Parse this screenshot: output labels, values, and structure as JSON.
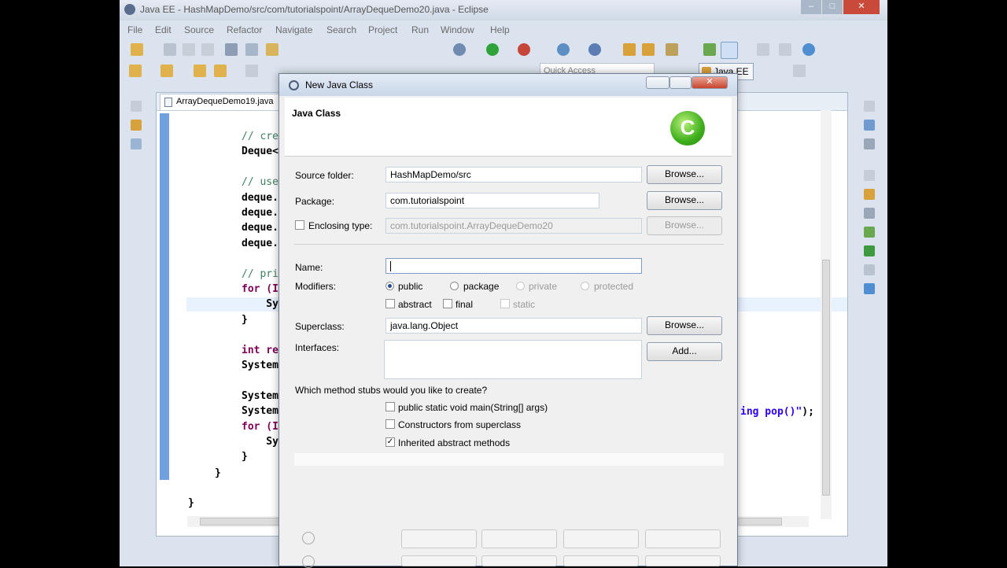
{
  "window": {
    "title": "Java EE - HashMapDemo/src/com/tutorialspoint/ArrayDequeDemo20.java - Eclipse",
    "controls": [
      "–",
      "□",
      "✕"
    ]
  },
  "menu": [
    "File",
    "Edit",
    "Source",
    "Refactor",
    "Navigate",
    "Search",
    "Project",
    "Run",
    "Window",
    "Help"
  ],
  "toolbar": {
    "quick_access_placeholder": "Quick Access",
    "perspective_label": "Java EE"
  },
  "editor": {
    "tab_label": "ArrayDequeDemo19.java",
    "code_lines": [
      {
        "cls": "c-cmt",
        "text": "// cre"
      },
      {
        "cls": "",
        "text": "Deque<"
      },
      {
        "cls": "",
        "text": ""
      },
      {
        "cls": "c-cmt",
        "text": "// use"
      },
      {
        "cls": "",
        "text": "deque."
      },
      {
        "cls": "",
        "text": "deque."
      },
      {
        "cls": "",
        "text": "deque."
      },
      {
        "cls": "",
        "text": "deque."
      },
      {
        "cls": "",
        "text": ""
      },
      {
        "cls": "c-cmt",
        "text": "// pri"
      },
      {
        "cls": "c-kw",
        "text": "for (I"
      },
      {
        "cls": "",
        "text": "    Sy"
      },
      {
        "cls": "",
        "text": "}"
      },
      {
        "cls": "",
        "text": ""
      },
      {
        "cls": "c-kw",
        "text": "int re"
      },
      {
        "cls": "",
        "text": "System"
      },
      {
        "cls": "",
        "text": ""
      },
      {
        "cls": "",
        "text": "System"
      },
      {
        "cls": "",
        "text": "System"
      },
      {
        "cls": "c-kw",
        "text": "for (I"
      },
      {
        "cls": "",
        "text": "    Sy"
      },
      {
        "cls": "",
        "text": "}"
      }
    ],
    "closing_brace_inner": "}",
    "closing_brace_outer": "}",
    "right_fragment_str": "ing pop()\"",
    "right_fragment_end": ");"
  },
  "dialog": {
    "title": "New Java Class",
    "heading": "Java Class",
    "class_icon_letter": "C",
    "source_folder_label": "Source folder:",
    "source_folder_value": "HashMapDemo/src",
    "package_label": "Package:",
    "package_value": "com.tutorialspoint",
    "enclosing_type_label": "Enclosing type:",
    "enclosing_type_value": "com.tutorialspoint.ArrayDequeDemo20",
    "browse_label": "Browse...",
    "name_label": "Name:",
    "name_value": "",
    "modifiers_label": "Modifiers:",
    "modifier_public": "public",
    "modifier_package": "package",
    "modifier_private": "private",
    "modifier_protected": "protected",
    "modifier_abstract": "abstract",
    "modifier_final": "final",
    "modifier_static": "static",
    "superclass_label": "Superclass:",
    "superclass_value": "java.lang.Object",
    "interfaces_label": "Interfaces:",
    "add_label": "Add...",
    "stubs_question": "Which method stubs would you like to create?",
    "stub_main": "public static void main(String[] args)",
    "stub_constructors": "Constructors from superclass",
    "stub_inherited": "Inherited abstract methods",
    "stub_inherited_checked": "✓"
  }
}
